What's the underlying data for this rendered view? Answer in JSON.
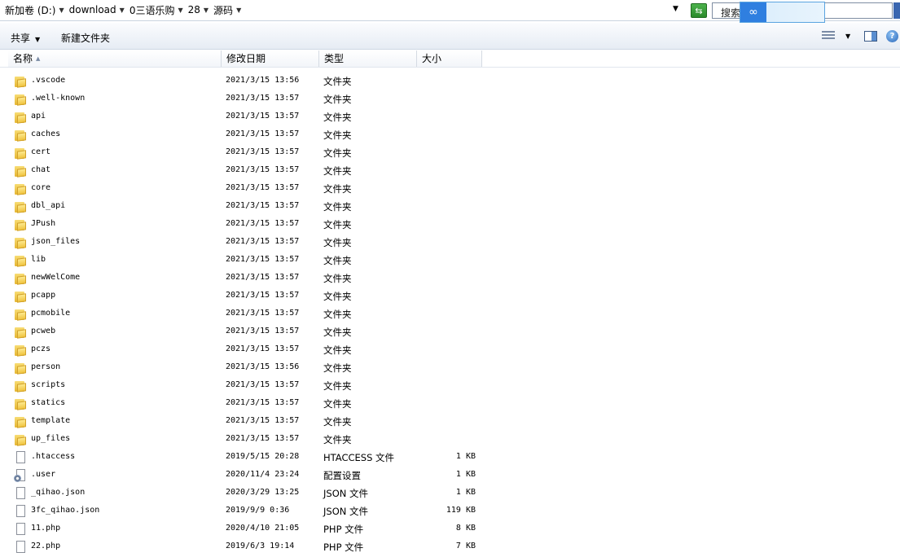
{
  "address": {
    "breadcrumbs": [
      "新加卷 (D:)",
      "download",
      "0三语乐购",
      "28",
      "源码"
    ],
    "dropdown_glyph": "▼",
    "search_placeholder": "搜索"
  },
  "toolbar": {
    "share_label": "共享",
    "new_folder_label": "新建文件夹"
  },
  "columns": {
    "name": "名称",
    "date": "修改日期",
    "type": "类型",
    "size": "大小"
  },
  "files": [
    {
      "name": ".vscode",
      "date": "2021/3/15 13:56",
      "type": "文件夹",
      "size": "",
      "icon": "folder-icon"
    },
    {
      "name": ".well-known",
      "date": "2021/3/15 13:57",
      "type": "文件夹",
      "size": "",
      "icon": "folder-icon"
    },
    {
      "name": "api",
      "date": "2021/3/15 13:57",
      "type": "文件夹",
      "size": "",
      "icon": "folder-icon"
    },
    {
      "name": "caches",
      "date": "2021/3/15 13:57",
      "type": "文件夹",
      "size": "",
      "icon": "folder-icon"
    },
    {
      "name": "cert",
      "date": "2021/3/15 13:57",
      "type": "文件夹",
      "size": "",
      "icon": "folder-icon"
    },
    {
      "name": "chat",
      "date": "2021/3/15 13:57",
      "type": "文件夹",
      "size": "",
      "icon": "folder-icon"
    },
    {
      "name": "core",
      "date": "2021/3/15 13:57",
      "type": "文件夹",
      "size": "",
      "icon": "folder-icon"
    },
    {
      "name": "dbl_api",
      "date": "2021/3/15 13:57",
      "type": "文件夹",
      "size": "",
      "icon": "folder-icon"
    },
    {
      "name": "JPush",
      "date": "2021/3/15 13:57",
      "type": "文件夹",
      "size": "",
      "icon": "folder-icon"
    },
    {
      "name": "json_files",
      "date": "2021/3/15 13:57",
      "type": "文件夹",
      "size": "",
      "icon": "folder-icon"
    },
    {
      "name": "lib",
      "date": "2021/3/15 13:57",
      "type": "文件夹",
      "size": "",
      "icon": "folder-icon"
    },
    {
      "name": "newWelCome",
      "date": "2021/3/15 13:57",
      "type": "文件夹",
      "size": "",
      "icon": "folder-icon"
    },
    {
      "name": "pcapp",
      "date": "2021/3/15 13:57",
      "type": "文件夹",
      "size": "",
      "icon": "folder-icon"
    },
    {
      "name": "pcmobile",
      "date": "2021/3/15 13:57",
      "type": "文件夹",
      "size": "",
      "icon": "folder-icon"
    },
    {
      "name": "pcweb",
      "date": "2021/3/15 13:57",
      "type": "文件夹",
      "size": "",
      "icon": "folder-icon"
    },
    {
      "name": "pczs",
      "date": "2021/3/15 13:57",
      "type": "文件夹",
      "size": "",
      "icon": "folder-icon"
    },
    {
      "name": "person",
      "date": "2021/3/15 13:56",
      "type": "文件夹",
      "size": "",
      "icon": "folder-icon"
    },
    {
      "name": "scripts",
      "date": "2021/3/15 13:57",
      "type": "文件夹",
      "size": "",
      "icon": "folder-icon"
    },
    {
      "name": "statics",
      "date": "2021/3/15 13:57",
      "type": "文件夹",
      "size": "",
      "icon": "folder-icon"
    },
    {
      "name": "template",
      "date": "2021/3/15 13:57",
      "type": "文件夹",
      "size": "",
      "icon": "folder-icon"
    },
    {
      "name": "up_files",
      "date": "2021/3/15 13:57",
      "type": "文件夹",
      "size": "",
      "icon": "folder-icon"
    },
    {
      "name": ".htaccess",
      "date": "2019/5/15 20:28",
      "type": "HTACCESS 文件",
      "size": "1 KB",
      "icon": "file-icon"
    },
    {
      "name": ".user",
      "date": "2020/11/4 23:24",
      "type": "配置设置",
      "size": "1 KB",
      "icon": "settings-file-icon"
    },
    {
      "name": "_qihao.json",
      "date": "2020/3/29 13:25",
      "type": "JSON 文件",
      "size": "1 KB",
      "icon": "file-icon"
    },
    {
      "name": "3fc_qihao.json",
      "date": "2019/9/9 0:36",
      "type": "JSON 文件",
      "size": "119 KB",
      "icon": "file-icon"
    },
    {
      "name": "11.php",
      "date": "2020/4/10 21:05",
      "type": "PHP 文件",
      "size": "8 KB",
      "icon": "file-icon"
    },
    {
      "name": "22.php",
      "date": "2019/6/3 19:14",
      "type": "PHP 文件",
      "size": "7 KB",
      "icon": "file-icon"
    }
  ]
}
